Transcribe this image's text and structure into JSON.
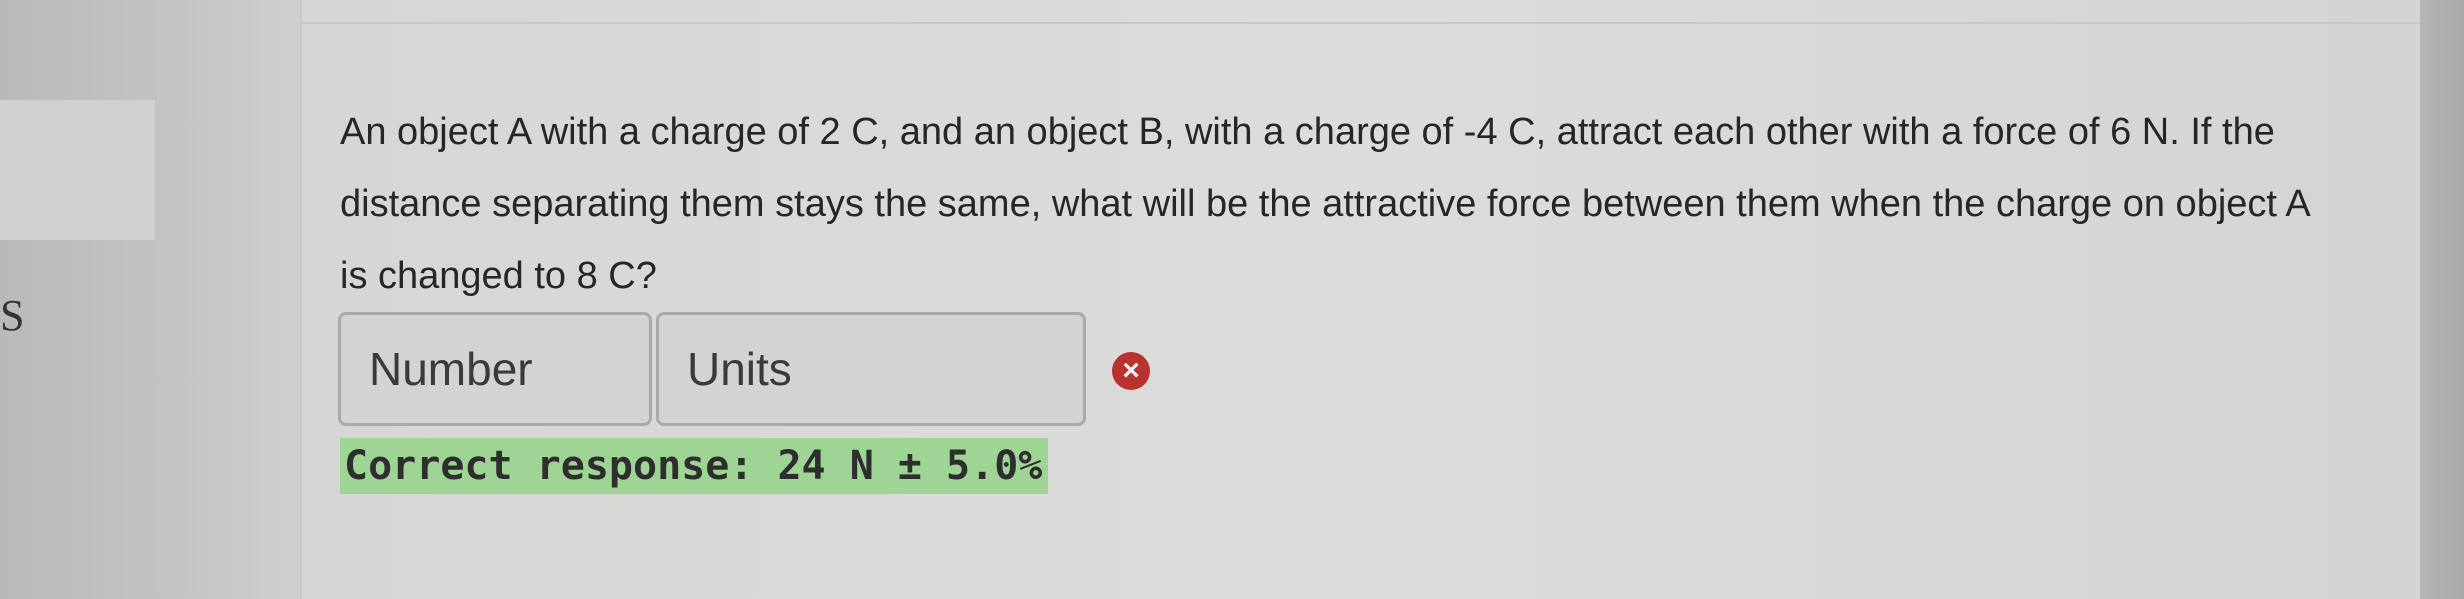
{
  "sidebar": {
    "partial_letter": "S"
  },
  "question": {
    "text": "An object A  with a charge of 2 C, and an object B, with a charge of -4 C, attract each other with a force of 6 N. If the distance separating them stays the same, what will be the attractive force between them when the charge on object A is changed to 8 C?"
  },
  "answer": {
    "number_placeholder": "Number",
    "units_placeholder": "Units",
    "status_icon": "x-circle-icon",
    "status_color": "#b8322f",
    "correct_response": "Correct response: 24 N ± 5.0%",
    "correct_highlight_color": "#9ed594"
  }
}
